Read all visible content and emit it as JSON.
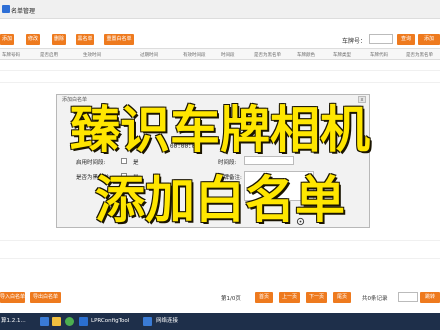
{
  "window": {
    "title": "名单管理"
  },
  "toolbar": {
    "buttons": [
      "添加",
      "修改",
      "删除",
      "黑名单",
      "重置白名单"
    ],
    "plate_label": "车牌号：",
    "query_label": "查询",
    "add_label": "添加"
  },
  "table": {
    "headers": [
      "车牌号码",
      "是否启用",
      "生效时间",
      "过期时间",
      "有效时间段",
      "时间段",
      "是否为黑名单",
      "车牌颜色",
      "车牌类型",
      "车牌代码",
      "是否为黑名单"
    ]
  },
  "dialog": {
    "title": "添加白名单",
    "close": "x",
    "time_text": "00:00:00",
    "time_text2": "-",
    "enable_time_label": "启用时间段:",
    "enable_time_value": "是",
    "time_period_label": "时间段:",
    "blacklist_label": "是否为黑名单:",
    "blacklist_value": "是",
    "remark_label": "车牌备注:"
  },
  "overlay": {
    "line1": "臻识车牌相机",
    "line2": "添加白名单"
  },
  "footer": {
    "import_label": "导入白名单",
    "export_label": "导出白名单",
    "page_info": "第1/0页",
    "first": "首页",
    "prev": "上一页",
    "next": "下一页",
    "last": "尾页",
    "record_info": "共0条记录",
    "goto": "跳转"
  },
  "taskbar": {
    "items": [
      "算1.2.1...",
      "LPRConfigTool",
      "网络连接"
    ]
  },
  "colors": {
    "accent": "#ee7a1e",
    "banner": "#ffe600",
    "taskbar": "#1e2f4a"
  }
}
